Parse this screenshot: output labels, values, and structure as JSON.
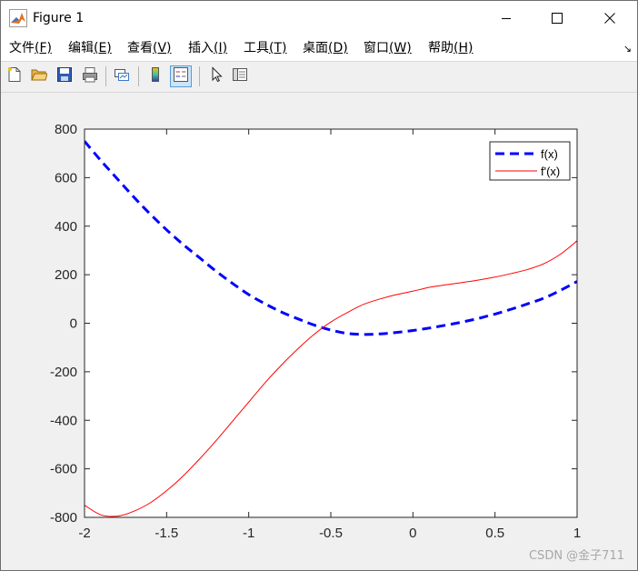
{
  "window": {
    "title": "Figure 1",
    "icons": {
      "app": "matlab-logo-icon",
      "minimize": "minimize-icon",
      "maximize": "maximize-icon",
      "close": "close-icon"
    }
  },
  "menubar": {
    "items": [
      {
        "label": "文件",
        "mnemonic": "(F)"
      },
      {
        "label": "编辑",
        "mnemonic": "(E)"
      },
      {
        "label": "查看",
        "mnemonic": "(V)"
      },
      {
        "label": "插入",
        "mnemonic": "(I)"
      },
      {
        "label": "工具",
        "mnemonic": "(T)"
      },
      {
        "label": "桌面",
        "mnemonic": "(D)"
      },
      {
        "label": "窗口",
        "mnemonic": "(W)"
      },
      {
        "label": "帮助",
        "mnemonic": "(H)"
      }
    ],
    "overflow_icon": "dock-arrow-icon"
  },
  "toolbar": {
    "buttons": [
      "new-figure-icon",
      "open-file-icon",
      "save-icon",
      "print-icon",
      "link-plot-icon",
      "insert-colorbar-icon",
      "insert-legend-icon",
      "edit-plot-pointer-icon",
      "property-inspector-icon"
    ],
    "active": "insert-legend-icon"
  },
  "chart_data": {
    "type": "line",
    "title": "",
    "xlabel": "",
    "ylabel": "",
    "xlim": [
      -2,
      1
    ],
    "ylim": [
      -800,
      800
    ],
    "xticks": [
      "-2",
      "-1.5",
      "-1",
      "-0.5",
      "0",
      "0.5",
      "1"
    ],
    "yticks": [
      "-800",
      "-600",
      "-400",
      "-200",
      "0",
      "200",
      "400",
      "600",
      "800"
    ],
    "grid": false,
    "legend_position": "top-right",
    "series": [
      {
        "name": "f(x)",
        "color": "#0000ff",
        "style": "dashed",
        "x": [
          -2,
          -1.9,
          -1.8,
          -1.7,
          -1.6,
          -1.5,
          -1.4,
          -1.3,
          -1.2,
          -1.1,
          -1.0,
          -0.9,
          -0.8,
          -0.7,
          -0.6,
          -0.5,
          -0.4,
          -0.3,
          -0.2,
          -0.1,
          0,
          0.1,
          0.2,
          0.3,
          0.4,
          0.5,
          0.6,
          0.7,
          0.8,
          0.9,
          1.0
        ],
        "y": [
          750,
          670,
          595,
          520,
          450,
          385,
          325,
          270,
          215,
          165,
          118,
          80,
          46,
          18,
          -8,
          -28,
          -42,
          -46,
          -44,
          -38,
          -30,
          -20,
          -8,
          5,
          20,
          38,
          58,
          80,
          104,
          136,
          172
        ]
      },
      {
        "name": "f'(x)",
        "color": "#ff0000",
        "style": "solid",
        "x": [
          -2,
          -1.9,
          -1.8,
          -1.7,
          -1.6,
          -1.5,
          -1.4,
          -1.3,
          -1.2,
          -1.1,
          -1.0,
          -0.9,
          -0.8,
          -0.7,
          -0.6,
          -0.5,
          -0.4,
          -0.3,
          -0.2,
          -0.1,
          0,
          0.1,
          0.2,
          0.3,
          0.4,
          0.5,
          0.6,
          0.7,
          0.8,
          0.9,
          1.0
        ],
        "y": [
          -750,
          -790,
          -795,
          -775,
          -740,
          -690,
          -630,
          -560,
          -485,
          -405,
          -325,
          -245,
          -172,
          -105,
          -45,
          5,
          44,
          78,
          100,
          118,
          132,
          148,
          158,
          168,
          178,
          190,
          205,
          222,
          246,
          285,
          340
        ]
      }
    ]
  },
  "watermark": "CSDN @金子711"
}
